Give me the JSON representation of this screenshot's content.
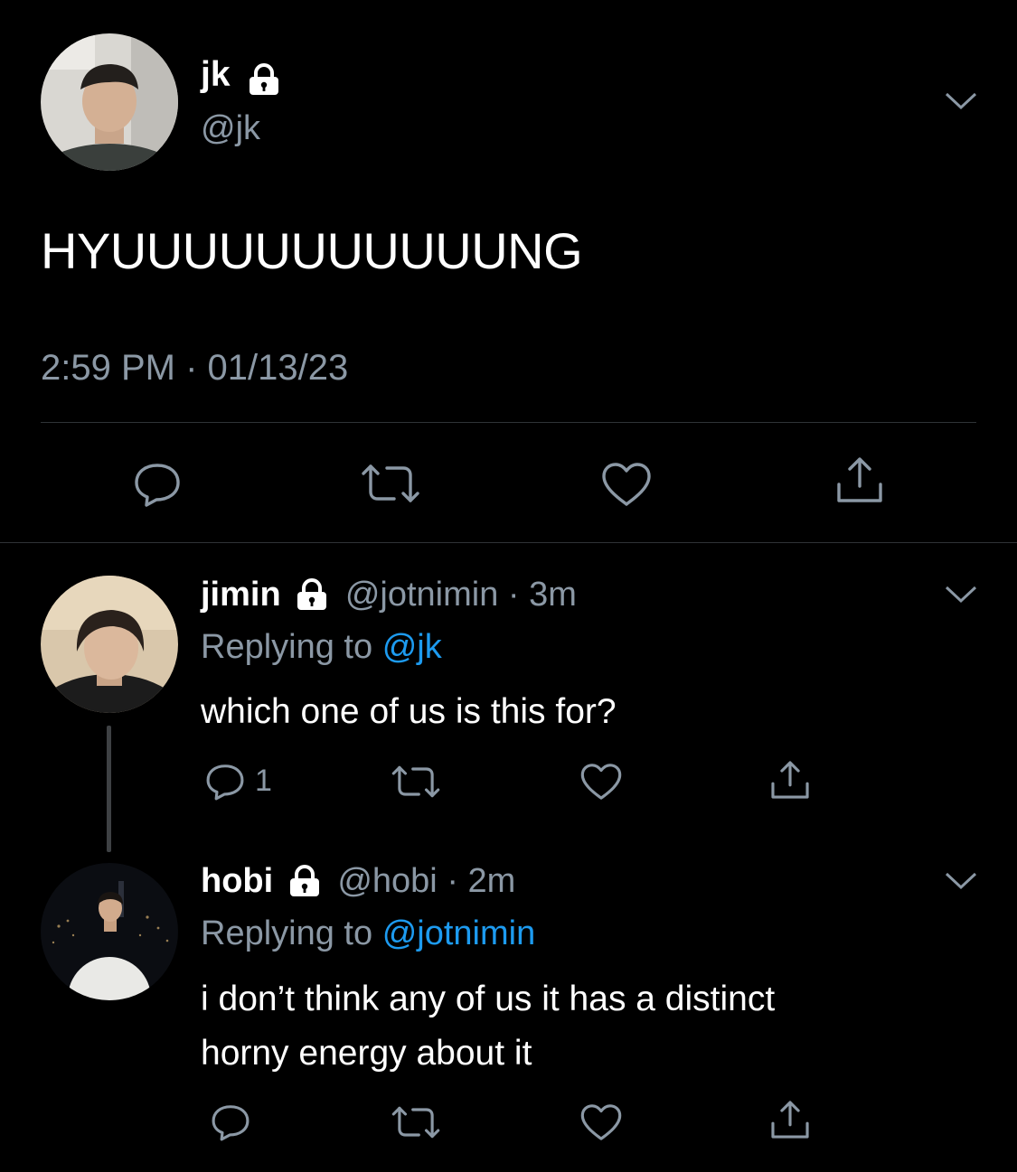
{
  "main_tweet": {
    "display_name": "jk",
    "handle": "@jk",
    "text": "HYUUUUUUUUUUUNG",
    "time": "2:59 PM",
    "separator": "·",
    "date": "01/13/23",
    "icons": [
      "reply-icon",
      "retweet-icon",
      "like-icon",
      "share-icon"
    ]
  },
  "replies": [
    {
      "display_name": "jimin",
      "handle": "@jotnimin",
      "separator": "·",
      "age": "3m",
      "replying_prefix": "Replying to",
      "replying_to": "@jk",
      "text_lines": [
        "which one of us is this for?"
      ],
      "reply_count": "1"
    },
    {
      "display_name": "hobi",
      "handle": "@hobi",
      "separator": "·",
      "age": "2m",
      "replying_prefix": "Replying to",
      "replying_to": "@jotnimin",
      "text_lines": [
        "i don’t think any of us it has a distinct",
        "horny energy about it"
      ],
      "reply_count": ""
    }
  ],
  "colors": {
    "background": "#000000",
    "text": "#ffffff",
    "secondary": "#8b98a5",
    "link": "#1d9bf0",
    "divider": "#2f3336"
  }
}
